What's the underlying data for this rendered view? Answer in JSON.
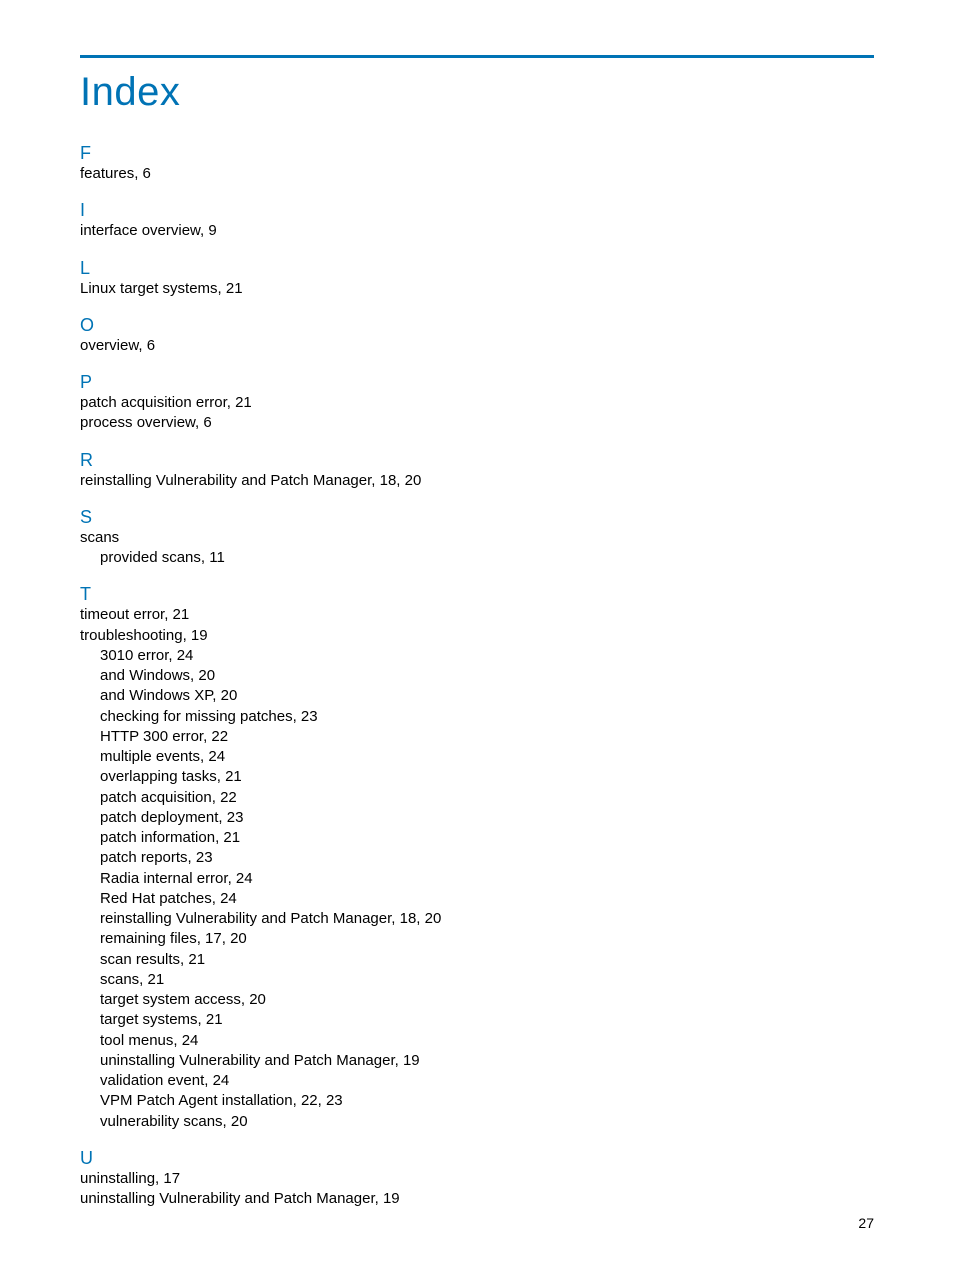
{
  "title": "Index",
  "page_number": "27",
  "sections": {
    "F": {
      "letter": "F",
      "e0": "features, 6"
    },
    "I": {
      "letter": "I",
      "e0": "interface overview, 9"
    },
    "L": {
      "letter": "L",
      "e0": "Linux target systems, 21"
    },
    "O": {
      "letter": "O",
      "e0": "overview, 6"
    },
    "P": {
      "letter": "P",
      "e0": "patch acquisition error, 21",
      "e1": "process overview, 6"
    },
    "R": {
      "letter": "R",
      "e0": "reinstalling Vulnerability and Patch Manager, 18, 20"
    },
    "S": {
      "letter": "S",
      "e0": "scans",
      "s0": "provided scans, 11"
    },
    "T": {
      "letter": "T",
      "e0": "timeout error, 21",
      "e1": "troubleshooting, 19",
      "s0": "3010 error, 24",
      "s1": "and Windows, 20",
      "s2": "and Windows XP, 20",
      "s3": "checking for missing patches, 23",
      "s4": "HTTP 300 error, 22",
      "s5": "multiple events, 24",
      "s6": "overlapping tasks, 21",
      "s7": "patch acquisition, 22",
      "s8": "patch deployment, 23",
      "s9": "patch information, 21",
      "s10": "patch reports, 23",
      "s11": "Radia internal error, 24",
      "s12": "Red Hat patches, 24",
      "s13": "reinstalling Vulnerability and Patch Manager, 18, 20",
      "s14": "remaining files, 17, 20",
      "s15": "scan results, 21",
      "s16": "scans, 21",
      "s17": "target system access, 20",
      "s18": "target systems, 21",
      "s19": "tool menus, 24",
      "s20": "uninstalling Vulnerability and Patch Manager, 19",
      "s21": "validation event, 24",
      "s22": "VPM Patch Agent installation, 22, 23",
      "s23": "vulnerability scans, 20"
    },
    "U": {
      "letter": "U",
      "e0": "uninstalling, 17",
      "e1": "uninstalling Vulnerability and Patch Manager, 19"
    }
  }
}
